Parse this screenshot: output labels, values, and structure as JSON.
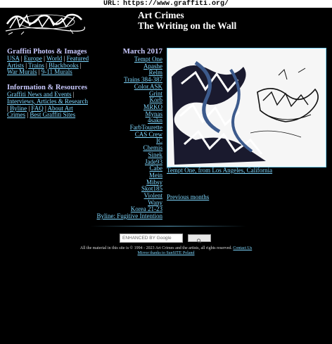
{
  "url_bar": {
    "label": "URL:",
    "url": "https://www.graffiti.org/"
  },
  "header": {
    "title_line1": "Art Crimes",
    "title_line2": "The Writing on the Wall"
  },
  "left": {
    "section1": {
      "heading": "Graffiti Photos & Images",
      "links": [
        "USA",
        "Europe",
        "World",
        "Featured Artists",
        "Trains",
        "Blackbooks",
        "War Murals",
        "9-11 Murals"
      ]
    },
    "section2": {
      "heading": "Information & Resources",
      "links": [
        "Graffiti News and Events",
        "Interviews, Articles & Research",
        "Byline",
        "FAQ",
        "About Art Crimes",
        "Best Graffiti Sites"
      ]
    }
  },
  "month": {
    "heading": "March 2017",
    "links": [
      "Tempt One",
      "Apashe",
      "Relm",
      "Trains 384-387",
      "Color.ASK",
      "Grint",
      "Korb",
      "MRKO",
      "Mynas",
      "4sakn",
      "FarbTourette",
      "CAS Crew",
      "IC",
      "Chemis",
      "Sinek",
      "Jade93",
      "Cabe",
      "Mein",
      "Mibsy",
      "Skot185",
      "Violent",
      "Wany",
      "Korea 21-23",
      "Byline: Fugitive Intention"
    ]
  },
  "feature": {
    "caption": "Tempt One, from Los Angeles, California"
  },
  "previous": "Previous months",
  "search": {
    "placeholder": "ENHANCED BY Google"
  },
  "footer": {
    "copyright": "All the material in this site is © 1994 - 2023 Art Crimes and the artists, all rights reserved.",
    "contact": "Contact Us",
    "mirror": "Mirror thanks to SunSITE Poland"
  }
}
